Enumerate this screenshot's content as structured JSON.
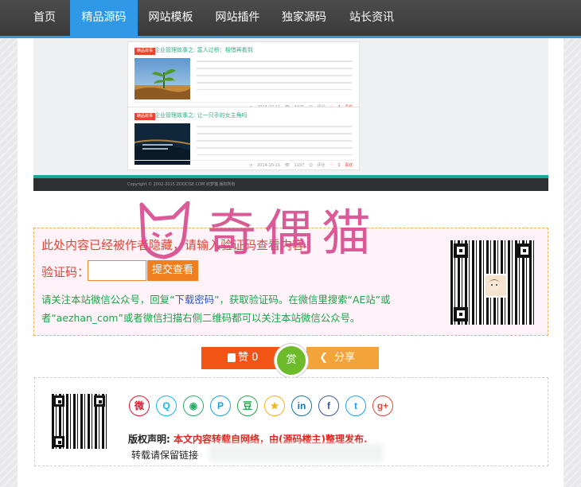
{
  "nav": {
    "items": [
      {
        "label": "首页",
        "active": false
      },
      {
        "label": "精品源码",
        "active": true
      },
      {
        "label": "网站模板",
        "active": false
      },
      {
        "label": "网站插件",
        "active": false
      },
      {
        "label": "独家源码",
        "active": false
      },
      {
        "label": "站长资讯",
        "active": false
      }
    ]
  },
  "preview": {
    "cards": [
      {
        "tag": "精品故事",
        "title": "企业管理故事之: 富人过桥：相惜再看到",
        "meta": "◷ 2014-10-11   👁 4375   ☺ 评论",
        "likes": "♡ 4 喜欢"
      },
      {
        "tag": "精品故事",
        "title": "企业管理故事之: 让一只手的女主角吗",
        "meta": "◷ 2014-10-11   👁 1197   ☺ 评论",
        "likes": "♡ 1 喜欢"
      }
    ],
    "copyright": "Copyright © 2002-2015 ZOOCISE.COM 织梦猫 版权所有"
  },
  "hidden": {
    "title": "此处内容已经被作者隐藏，请输入验证码查看内容",
    "code_label": "验证码：",
    "input_value": "",
    "submit_label": "提交查看",
    "desc_before": "请关注本站微信公众号，回复“",
    "desc_keyword": "下载密码",
    "desc_after": "”，获取验证码。在微信里搜索“AE站”或者“aezhan_com”或者微信扫描右侧二维码都可以关注本站微信公众号。"
  },
  "watermark": {
    "text": "奇偶猫",
    "color": "#d64a8d"
  },
  "actions": {
    "like_label": "赞 0",
    "reward_label": "赏",
    "share_label": "分享",
    "like_color": "#f25415",
    "reward_color": "#6dbb2a",
    "share_color": "#f2a43a"
  },
  "share": {
    "icons": [
      {
        "name": "weibo-icon",
        "glyph": "微",
        "color": "#e6162d"
      },
      {
        "name": "qq-icon",
        "glyph": "Q",
        "color": "#12b7f5"
      },
      {
        "name": "wechat-icon",
        "glyph": "◉",
        "color": "#2aae67"
      },
      {
        "name": "pinterest-icon",
        "glyph": "P",
        "color": "#1ba1e2"
      },
      {
        "name": "douban-icon",
        "glyph": "豆",
        "color": "#2aa64f"
      },
      {
        "name": "qzone-icon",
        "glyph": "★",
        "color": "#f5b21b"
      },
      {
        "name": "linkedin-icon",
        "glyph": "in",
        "color": "#0e76a8"
      },
      {
        "name": "facebook-icon",
        "glyph": "f",
        "color": "#3b5998"
      },
      {
        "name": "twitter-icon",
        "glyph": "t",
        "color": "#1da1f2"
      },
      {
        "name": "googleplus-icon",
        "glyph": "g+",
        "color": "#dd4b39"
      }
    ],
    "copyright_label": "版权声明:",
    "copyright_text": " 本文内容转载自网络，由(源码楼主)整理发布.",
    "reprint_text": "转载请保留链接"
  }
}
